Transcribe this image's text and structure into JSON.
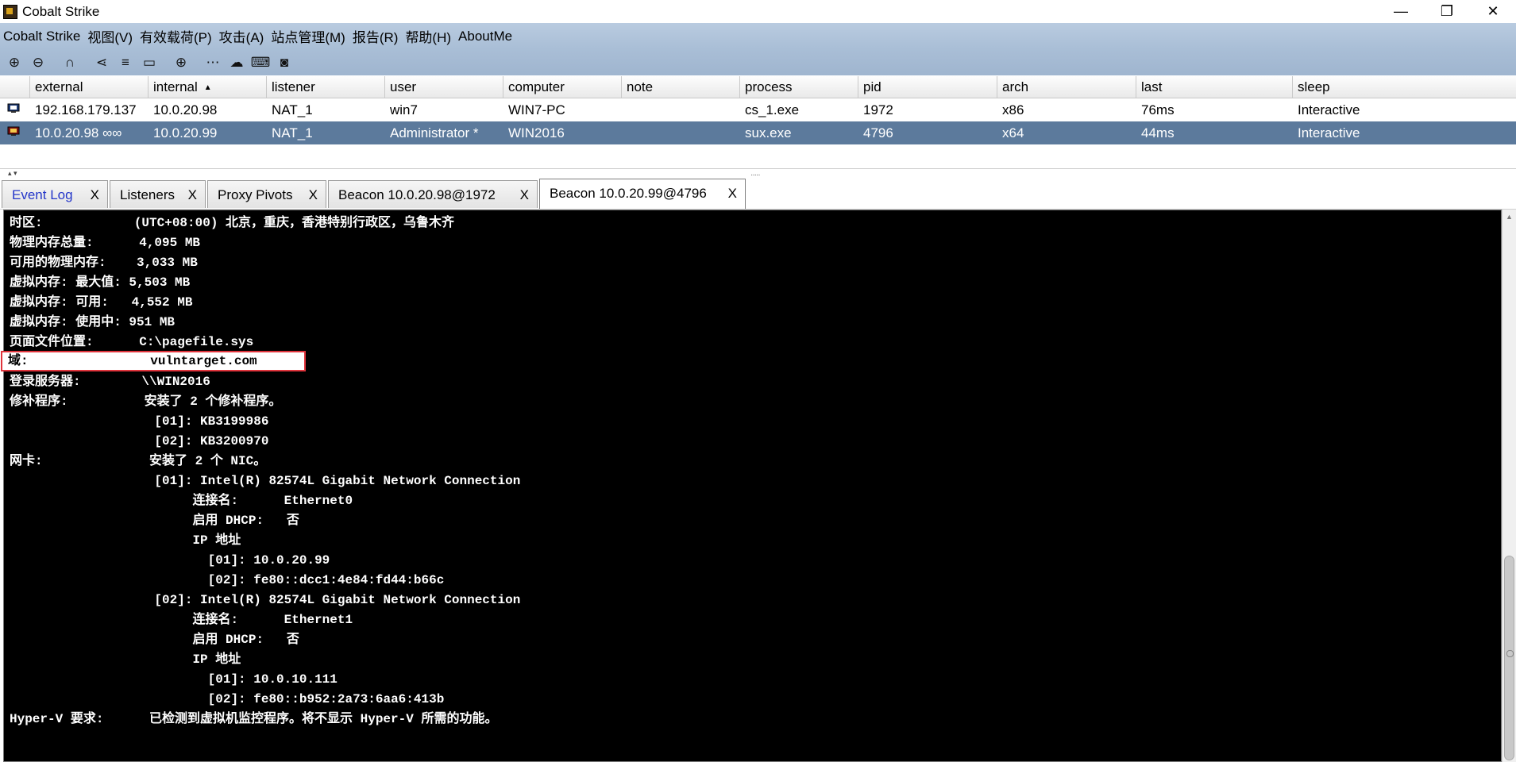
{
  "window": {
    "title": "Cobalt Strike",
    "minimize_glyph": "—",
    "restore_glyph": "❐",
    "close_glyph": "✕"
  },
  "menu": [
    "Cobalt Strike",
    "视图(V)",
    "有效载荷(P)",
    "攻击(A)",
    "站点管理(M)",
    "报告(R)",
    "帮助(H)",
    "AboutMe"
  ],
  "toolbar": [
    {
      "icon": "new-connection-icon",
      "glyph": "⊕"
    },
    {
      "icon": "disconnect-icon",
      "glyph": "⊖"
    },
    {
      "icon": "headphones-listeners-icon",
      "glyph": "∩"
    },
    {
      "icon": "pivot-graph-icon",
      "glyph": "⋖"
    },
    {
      "icon": "session-table-icon",
      "glyph": "≡"
    },
    {
      "icon": "targets-icon",
      "glyph": "▭"
    },
    {
      "icon": "web-log-icon",
      "glyph": "⊕"
    },
    {
      "icon": "credentials-icon",
      "glyph": "⋯"
    },
    {
      "icon": "downloads-icon",
      "glyph": "☁"
    },
    {
      "icon": "keystrokes-icon",
      "glyph": "⌨"
    },
    {
      "icon": "screenshots-icon",
      "glyph": "◙"
    }
  ],
  "sessions": {
    "columns": [
      "external",
      "internal",
      "listener",
      "user",
      "computer",
      "note",
      "process",
      "pid",
      "arch",
      "last",
      "sleep"
    ],
    "sort_glyph": "▲",
    "rows": [
      {
        "external": "192.168.179.137",
        "internal": "10.0.20.98",
        "listener": "NAT_1",
        "user": "win7",
        "computer": "WIN7-PC",
        "note": "",
        "process": "cs_1.exe",
        "pid": "1972",
        "arch": "x86",
        "last": "76ms",
        "sleep": "Interactive"
      },
      {
        "external": "10.0.20.98 ∞∞",
        "internal": "10.0.20.99",
        "listener": "NAT_1",
        "user": "Administrator *",
        "computer": "WIN2016",
        "note": "",
        "process": "sux.exe",
        "pid": "4796",
        "arch": "x64",
        "last": "44ms",
        "sleep": "Interactive"
      }
    ]
  },
  "splitter": {
    "arrows": "▴ ▾",
    "grip": "·····"
  },
  "tabs": [
    {
      "label": "Event Log",
      "close": "X"
    },
    {
      "label": "Listeners",
      "close": "X"
    },
    {
      "label": "Proxy Pivots",
      "close": "X"
    },
    {
      "label": "Beacon 10.0.20.98@1972",
      "close": "X"
    },
    {
      "label": "Beacon 10.0.20.99@4796",
      "close": "X",
      "active": true
    }
  ],
  "console": {
    "lines": [
      "时区:            (UTC+08:00) 北京，重庆，香港特别行政区，乌鲁木齐",
      "物理内存总量:      4,095 MB",
      "可用的物理内存:    3,033 MB",
      "虚拟内存: 最大值: 5,503 MB",
      "虚拟内存: 可用:   4,552 MB",
      "虚拟内存: 使用中: 951 MB",
      "页面文件位置:      C:\\pagefile.sys",
      "",
      "登录服务器:        \\\\WIN2016",
      "修补程序:          安装了 2 个修补程序。",
      "                   [01]: KB3199986",
      "                   [02]: KB3200970",
      "网卡:              安装了 2 个 NIC。",
      "                   [01]: Intel(R) 82574L Gigabit Network Connection",
      "                        连接名:      Ethernet0",
      "                        启用 DHCP:   否",
      "                        IP 地址",
      "                          [01]: 10.0.20.99",
      "                          [02]: fe80::dcc1:4e84:fd44:b66c",
      "                   [02]: Intel(R) 82574L Gigabit Network Connection",
      "                        连接名:      Ethernet1",
      "                        启用 DHCP:   否",
      "                        IP 地址",
      "                          [01]: 10.0.10.111",
      "                          [02]: fe80::b952:2a73:6aa6:413b",
      "Hyper-V 要求:      已检测到虚拟机监控程序。将不显示 Hyper-V 所需的功能。"
    ],
    "highlighted_line": "域:                vulntarget.com",
    "scroll_up_glyph": "▲"
  }
}
